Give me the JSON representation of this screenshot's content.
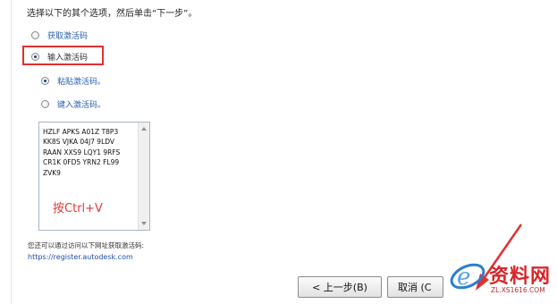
{
  "dialog": {
    "instruction": "选择以下的其个选项，然后单击“下一步”。",
    "options": {
      "get_code_label": "获取激活码",
      "enter_code_label": "输入激活码",
      "paste_code_label": "粘贴激活码。",
      "type_code_label": "键入激活码。"
    },
    "activation_code": {
      "lines": [
        "HZLF APKS A01Z T8P3",
        "KK8S VJKA 04J7 9LDV",
        "RAAN XXS9 LQY1 9RFS",
        "CR1K 0FD5 YRN2 FL99",
        "ZVK9"
      ],
      "hint": "按Ctrl+V"
    },
    "info_text": "您还可以通过访问以下网址获取激活码:",
    "url": "https://register.autodesk.com",
    "buttons": {
      "back_label": "< 上一步(B)",
      "cancel_label": "取消 (C"
    }
  },
  "watermark": {
    "logo_text": "资料网",
    "logo_sub": "ZL.XS1616.COM"
  },
  "colors": {
    "highlight_box": "#e03030",
    "annotation_arrow": "#e03030",
    "link": "#1f4fa8",
    "hint": "#e23a3a"
  }
}
